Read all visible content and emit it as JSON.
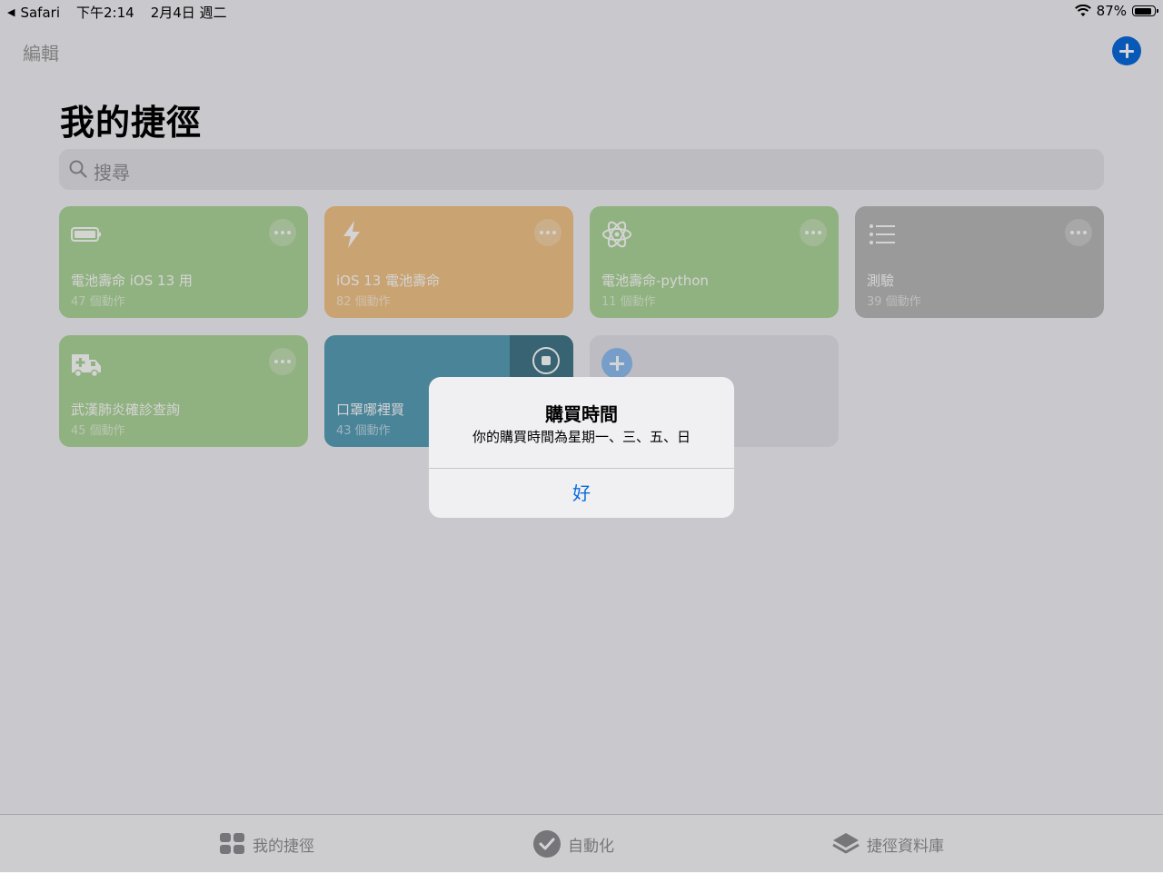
{
  "status_bar": {
    "back_app": "Safari",
    "time": "下午2:14",
    "date": "2月4日 週二",
    "battery": "87%",
    "battery_level": 0.87
  },
  "nav": {
    "edit": "編輯",
    "add_icon": "plus-circle-icon"
  },
  "page_title": "我的捷徑",
  "search": {
    "placeholder": "搜尋"
  },
  "shortcuts": [
    {
      "name": "電池壽命 iOS 13 用",
      "count": "47 個動作",
      "color": "#aed69b",
      "icon": "battery-icon"
    },
    {
      "name": "iOS 13 電池壽命",
      "count": "82 個動作",
      "color": "#f2c58a",
      "icon": "bolt-icon"
    },
    {
      "name": "電池壽命-python",
      "count": "11 個動作",
      "color": "#aed69b",
      "icon": "atom-icon"
    },
    {
      "name": "測驗",
      "count": "39 個動作",
      "color": "#bababa",
      "icon": "list-icon"
    },
    {
      "name": "武漢肺炎確診查詢",
      "count": "45 個動作",
      "color": "#aed69b",
      "icon": "ambulance-icon"
    },
    {
      "name": "口罩哪裡買",
      "count": "43 個動作",
      "color": "#5a9fb9",
      "icon": "stop-icon",
      "running": true
    }
  ],
  "tabs": [
    {
      "label": "我的捷徑",
      "icon": "grid-icon"
    },
    {
      "label": "自動化",
      "icon": "checkmark-clock-icon"
    },
    {
      "label": "捷徑資料庫",
      "icon": "layers-icon"
    }
  ],
  "alert": {
    "title": "購買時間",
    "message": "你的購買時間為星期一、三、五、日",
    "button": "好"
  },
  "colors": {
    "accent": "#0a6bdc",
    "green": "#aed69b",
    "orange": "#f2c58a",
    "gray": "#bababa",
    "teal": "#5a9fb9"
  }
}
